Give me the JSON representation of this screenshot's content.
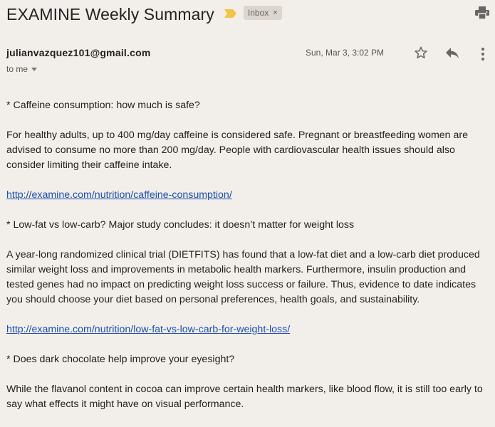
{
  "email": {
    "subject": "EXAMINE Weekly Summary",
    "label": "Inbox",
    "label_remove": "×",
    "sender": "julianvazquez101@gmail.com",
    "recipient": "to me",
    "date": "Sun, Mar 3, 3:02 PM"
  },
  "icons": {
    "importance": "importance-marker-icon",
    "print": "print-icon",
    "star": "star-icon",
    "reply": "reply-icon",
    "more": "more-vertical-icon",
    "caret": "chevron-down-icon"
  },
  "colors": {
    "background": "#f2eee9",
    "importance": "#f4c542",
    "link": "#1a4fb5",
    "chip": "#dcd6cf"
  },
  "body": {
    "p1": "* Caffeine consumption: how much is safe?",
    "p2": "For healthy adults, up to 400 mg/day caffeine is considered safe. Pregnant or breastfeeding women are advised to consume no more than 200 mg/day. People with cardiovascular health issues should also consider limiting their caffeine intake.",
    "link1": "http://examine.com/nutrition/caffeine-consumption/",
    "p3": "* Low-fat vs low-carb? Major study concludes: it doesn’t matter for weight loss",
    "p4": "A year-long randomized clinical trial (DIETFITS) has found that a low-fat diet and a low-carb diet produced similar weight loss and improvements in metabolic health markers. Furthermore, insulin production and tested genes had no impact on predicting weight loss success or failure. Thus, evidence to date indicates you should choose your diet based on personal preferences, health goals, and sustainability.",
    "link2": "http://examine.com/nutrition/low-fat-vs-low-carb-for-weight-loss/",
    "p5": "* Does dark chocolate help improve your eyesight?",
    "p6": "While the flavanol content in cocoa can improve certain health markers, like blood flow, it is still too early to say what effects it might have on visual performance."
  }
}
